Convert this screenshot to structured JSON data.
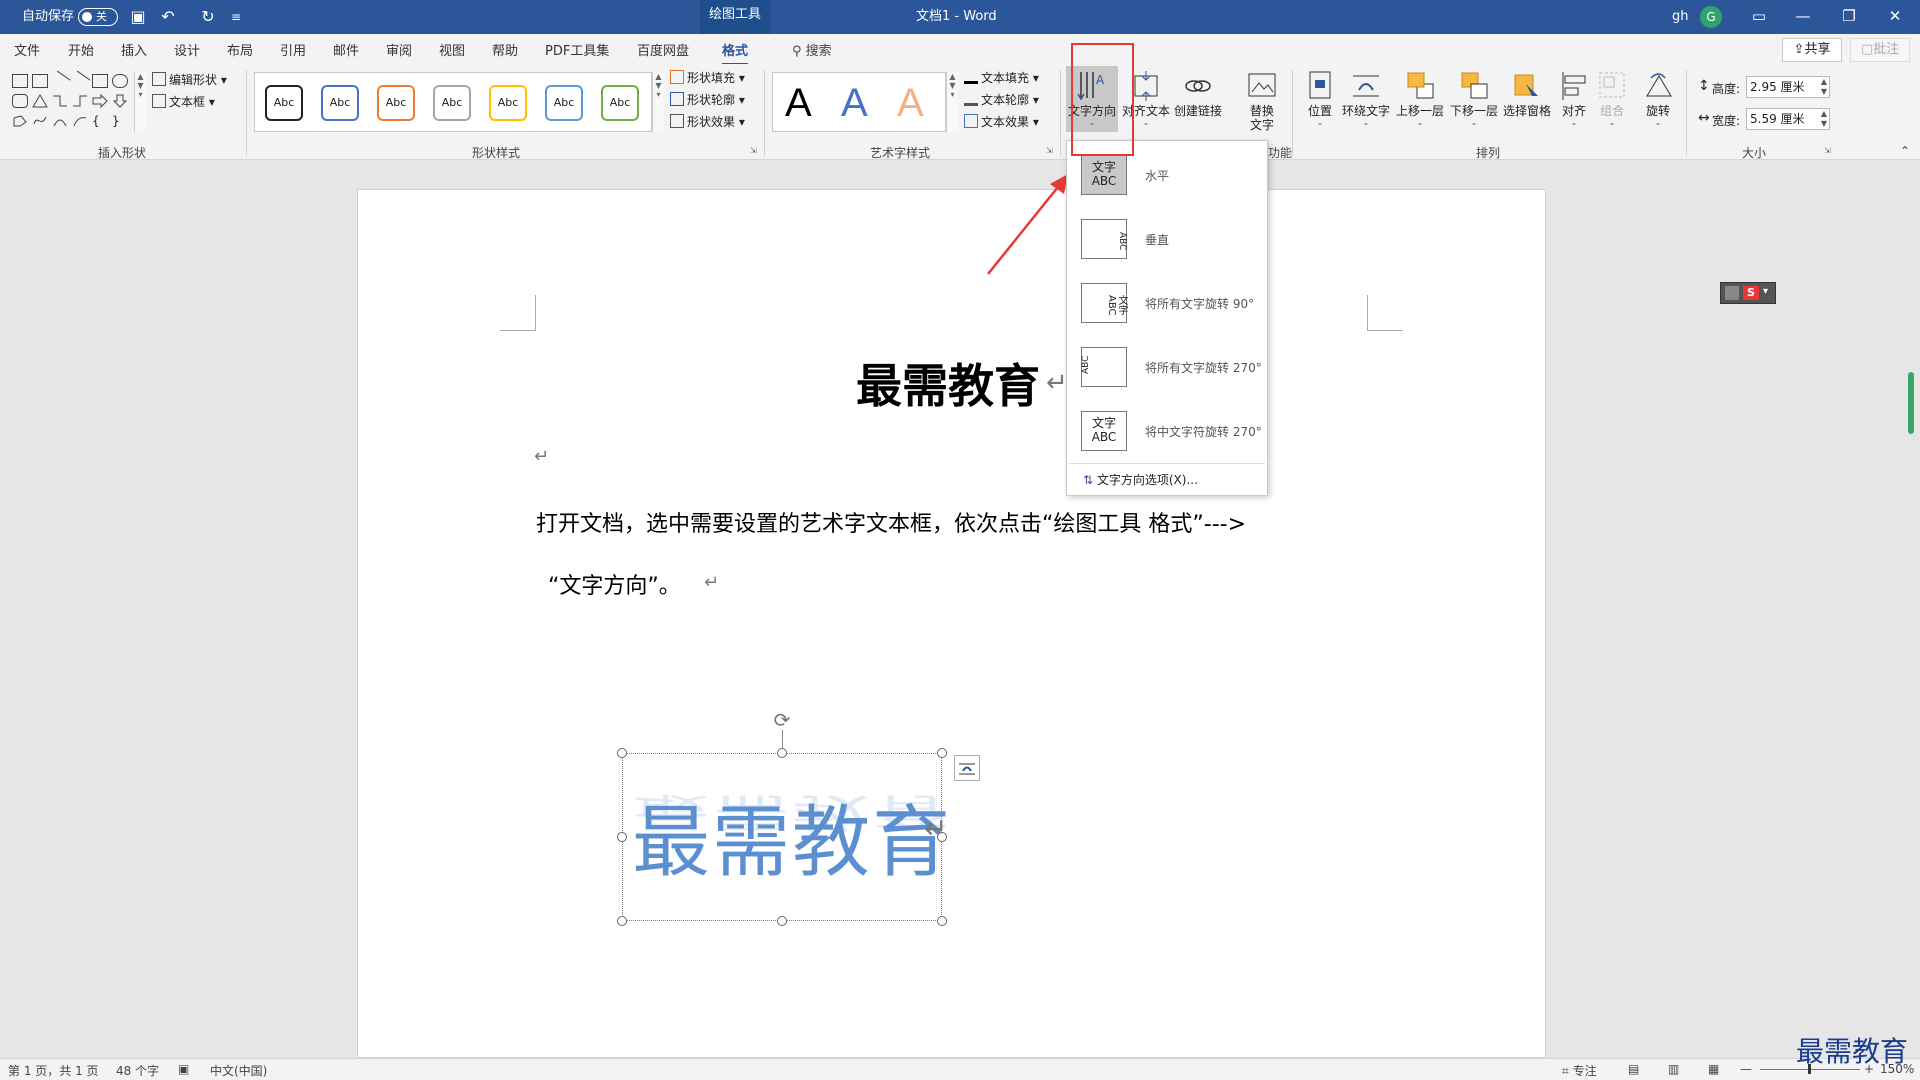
{
  "titlebar": {
    "autosave": "自动保存",
    "autosave_state": "关",
    "context_tab": "绘图工具",
    "doc_title": "文档1  -  Word",
    "user": "gh",
    "avatar_letter": "G"
  },
  "tabs": [
    "文件",
    "开始",
    "插入",
    "设计",
    "布局",
    "引用",
    "邮件",
    "审阅",
    "视图",
    "帮助",
    "PDF工具集",
    "百度网盘",
    "格式"
  ],
  "search": "搜索",
  "share": "共享",
  "comments": "批注",
  "ribbon": {
    "insert_shapes": {
      "edit_shape": "编辑形状",
      "text_box": "文本框",
      "label": "插入形状"
    },
    "shape_styles": {
      "sample": "Abc",
      "fill": "形状填充",
      "outline": "形状轮廓",
      "effects": "形状效果",
      "label": "形状样式"
    },
    "wordart": {
      "letter": "A",
      "text_fill": "文本填充",
      "text_outline": "文本轮廓",
      "text_effects": "文本效果",
      "label": "艺术字样式"
    },
    "text": {
      "direction": "文字方向",
      "align": "对齐文本",
      "link": "创建链接"
    },
    "accessibility": {
      "alt": "替换文字",
      "label_partial": "功能"
    },
    "arrange": {
      "position": "位置",
      "wrap": "环绕文字",
      "forward": "上移一层",
      "backward": "下移一层",
      "pane": "选择窗格",
      "align": "对齐",
      "group": "组合",
      "rotate": "旋转",
      "label": "排列"
    },
    "size": {
      "height_label": "高度:",
      "height": "2.95 厘米",
      "width_label": "宽度:",
      "width": "5.59 厘米",
      "label": "大小"
    }
  },
  "dropdown": {
    "items": [
      {
        "label": "水平",
        "icon_text": "文字ABC"
      },
      {
        "label": "垂直",
        "icon_text": "ABC"
      },
      {
        "label": "将所有文字旋转 90°",
        "icon_text": "文字ABC"
      },
      {
        "label": "将所有文字旋转 270°",
        "icon_text": "ABC"
      },
      {
        "label": "将中文字符旋转 270°",
        "icon_text": "文字ABC"
      }
    ],
    "options": "文字方向选项(X)..."
  },
  "document": {
    "title": "最需教育",
    "body_line1": "打开文档，选中需要设置的艺术字文本框，依次点击“绘图工具  格式”--->",
    "body_line2": "“文字方向”。",
    "wordart": "最需教育"
  },
  "statusbar": {
    "page": "第 1 页，共 1 页",
    "words": "48 个字",
    "language": "中文(中国)",
    "focus": "专注",
    "zoom": "150%"
  },
  "watermark": "最需教育"
}
